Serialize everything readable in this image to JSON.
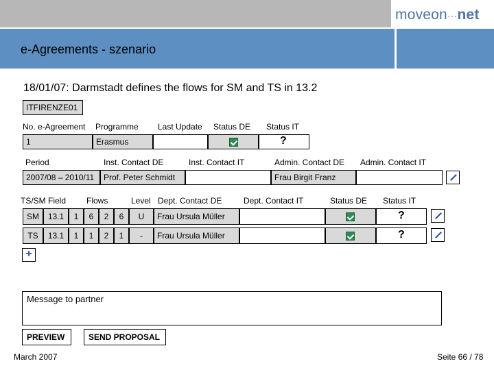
{
  "header": {
    "logo_left": "moveon",
    "logo_dots": "···",
    "logo_right": "net",
    "title": "e-Agreements - szenario",
    "subtitle": "18/01/07: Darmstadt defines the flows for SM and TS in 13.2"
  },
  "agreement": {
    "code": "ITFIRENZE01",
    "labels": {
      "no": "No. e-Agreement",
      "programme": "Programme",
      "last_update": "Last Update",
      "status_de": "Status DE",
      "status_it": "Status IT"
    },
    "values": {
      "no": "1",
      "programme": "Erasmus",
      "last_update": "",
      "status_it": "?"
    },
    "labels2": {
      "period": "Period",
      "inst_de": "Inst. Contact DE",
      "inst_it": "Inst. Contact IT",
      "admin_de": "Admin. Contact DE",
      "admin_it": "Admin. Contact IT"
    },
    "values2": {
      "period": "2007/08 – 2010/11",
      "inst_de": "Prof. Peter Schmidt",
      "inst_it": "",
      "admin_de": "Frau Birgit Franz",
      "admin_it": ""
    }
  },
  "flows": {
    "headers": {
      "field": "TS/SM Field",
      "flows": "Flows",
      "level": "Level",
      "dept_de": "Dept. Contact DE",
      "dept_it": "Dept. Contact IT",
      "status_de": "Status DE",
      "status_it": "Status IT"
    },
    "rows": [
      {
        "type": "SM",
        "field": "13.1",
        "f1": "1",
        "f2": "6",
        "f3": "2",
        "f4": "6",
        "level": "U",
        "dept_de": "Frau Ursula Müller",
        "dept_it": "",
        "status_it": "?"
      },
      {
        "type": "TS",
        "field": "13.1",
        "f1": "1",
        "f2": "1",
        "f3": "2",
        "f4": "1",
        "level": "-",
        "dept_de": "Frau Ursula Müller",
        "dept_it": "",
        "status_it": "?"
      }
    ],
    "add_label": "+"
  },
  "message": {
    "placeholder": "Message to partner"
  },
  "buttons": {
    "preview": "PREVIEW",
    "send": "SEND PROPOSAL"
  },
  "footer": {
    "date": "March 2007",
    "page": "Seite 66 / 78"
  },
  "colors": {
    "header_blue": "#5d8fc2",
    "top_gray": "#b7b7b7",
    "check_green": "#2e8b57"
  }
}
